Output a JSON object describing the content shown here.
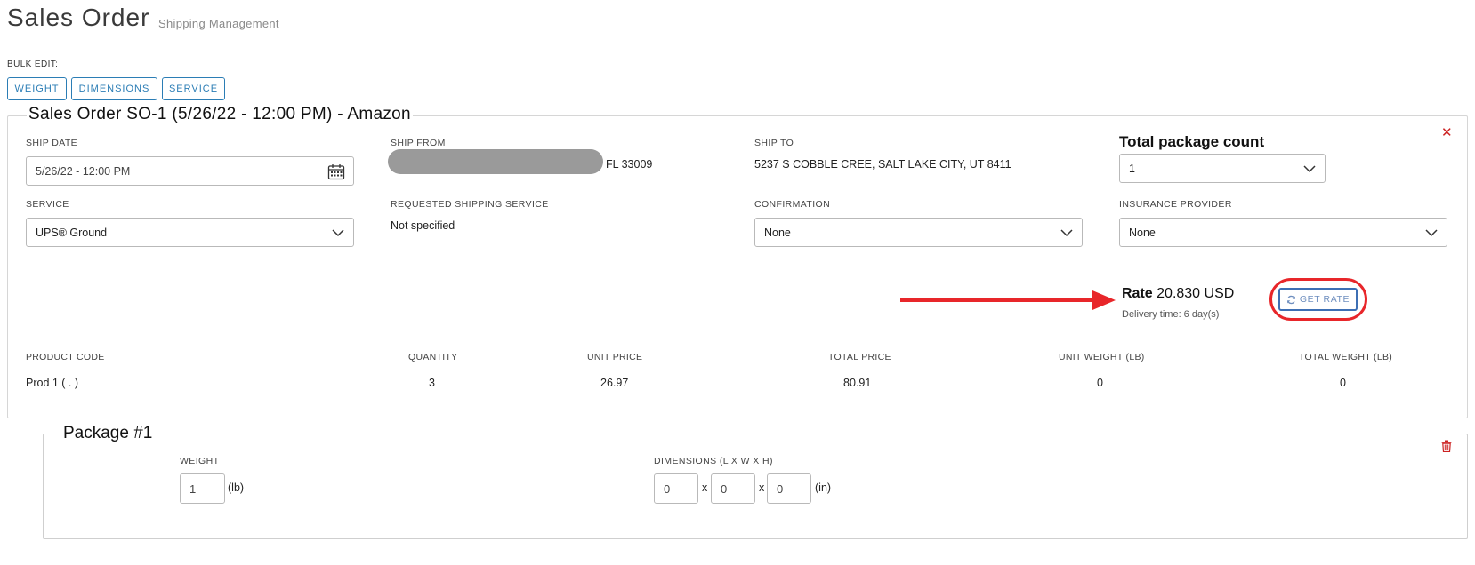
{
  "header": {
    "title": "Sales Order",
    "subtitle": "Shipping Management"
  },
  "bulk_edit": {
    "label": "BULK EDIT:",
    "buttons": [
      "WEIGHT",
      "DIMENSIONS",
      "SERVICE"
    ]
  },
  "order": {
    "legend": "Sales Order SO-1 (5/26/22 - 12:00 PM) - Amazon",
    "ship_date": {
      "label": "SHIP DATE",
      "value": "5/26/22 - 12:00 PM"
    },
    "ship_from": {
      "label": "SHIP FROM",
      "value": "FL 33009"
    },
    "ship_to": {
      "label": "SHIP TO",
      "value": "5237 S COBBLE CREE, SALT LAKE CITY, UT 8411"
    },
    "total_package_count": {
      "label": "Total package count",
      "value": "1"
    },
    "service": {
      "label": "SERVICE",
      "value": "UPS® Ground"
    },
    "requested_service": {
      "label": "REQUESTED SHIPPING SERVICE",
      "value": "Not specified"
    },
    "confirmation": {
      "label": "CONFIRMATION",
      "value": "None"
    },
    "insurance": {
      "label": "INSURANCE PROVIDER",
      "value": "None"
    },
    "rate": {
      "label": "Rate",
      "value": "20.830 USD",
      "delivery": "Delivery time: 6 day(s)",
      "button": "GET RATE"
    },
    "items_table": {
      "headers": [
        "PRODUCT CODE",
        "QUANTITY",
        "UNIT PRICE",
        "TOTAL PRICE",
        "UNIT WEIGHT (LB)",
        "TOTAL WEIGHT (LB)"
      ],
      "rows": [
        [
          "Prod 1 ( . )",
          "3",
          "26.97",
          "80.91",
          "0",
          "0"
        ]
      ]
    },
    "close_icon": "close-icon"
  },
  "package": {
    "legend": "Package #1",
    "weight_label": "WEIGHT",
    "weight_value": "1",
    "weight_unit": "(lb)",
    "dimensions_label": "DIMENSIONS (L X W X H)",
    "length": "0",
    "width": "0",
    "height": "0",
    "separator": "x",
    "dim_unit": "(in)",
    "delete_icon": "trash-icon"
  },
  "colors": {
    "accent": "#2b7db5",
    "highlight": "#e8262a",
    "close": "#cc2222"
  }
}
